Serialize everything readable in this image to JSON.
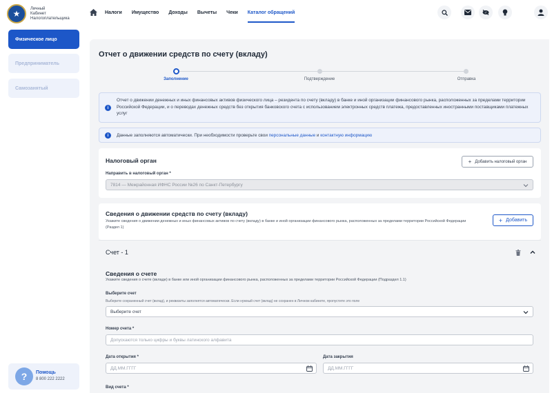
{
  "header": {
    "logo_text": [
      "Личный",
      "Кабинет",
      "Налогоплательщика"
    ],
    "nav": [
      "Налоги",
      "Имущество",
      "Доходы",
      "Вычеты",
      "Чеки",
      "Каталог обращений"
    ],
    "active_nav": "Каталог обращений"
  },
  "sidebar": {
    "items": [
      {
        "label": "Физическое лицо",
        "active": true
      },
      {
        "label": "Предприниматель",
        "active": false
      },
      {
        "label": "Самозанятый",
        "active": false
      }
    ],
    "help": {
      "title": "Помощь",
      "phone": "8 800 222 2222",
      "icon": "?"
    }
  },
  "page": {
    "title": "Отчет о движении средств по счету (вкладу)",
    "steps": [
      {
        "label": "Заполнение",
        "active": true
      },
      {
        "label": "Подтверждение",
        "active": false
      },
      {
        "label": "Отправка",
        "active": false
      }
    ],
    "info1": "Отчет о движении денежных и иных финансовых активов физического лица – резидента по счету (вкладу) в банке и иной организации финансового рынка, расположенных за пределами территории Российской Федерации, и о переводах денежных средств без открытия банковского счета с использованием электронных средств платежа, предоставленных иностранными поставщиками платежных услуг",
    "info2_prefix": "Данные заполняются автоматически. При необходимости проверьте свои ",
    "info2_link1": "персональные данные",
    "info2_mid": " и ",
    "info2_link2": "контактную информацию"
  },
  "tax": {
    "title": "Налоговый орган",
    "add_button": "Добавить налоговый орган",
    "label": "Направить в налоговый орган *",
    "value": "7814 — Межрайонная ИФНС России №26 по Санкт-Петербургу"
  },
  "movement": {
    "title": "Сведения о движении средств по счету (вкладу)",
    "subtitle": "Укажите сведения о движении денежных и иных финансовых активов по счету (вкладу) в банке и иной организации финансового рынка, расположенных за пределами территории Российской Федерации (Раздел 1)",
    "add_button": "Добавить"
  },
  "account": {
    "title": "Счет - 1",
    "section_title": "Сведения о счете",
    "section_sub": "Укажите сведения о счете (вкладе) в банке или иной организации финансового рынка, расположенных за пределами территории Российской Федерации (Подраздел 1.1)",
    "select_label": "Выберите счет",
    "select_hint": "Выберите сохраненный счет (вклад), и реквизиты заполнятся автоматически. Если нужный счет (вклад) не сохранен в Личном кабинете, пропустите это поле",
    "select_placeholder": "Выберите счет",
    "number_label": "Номер счета *",
    "number_placeholder": "Допускаются только цифры и буквы латинского алфавита",
    "open_label": "Дата открытия *",
    "open_placeholder": "ДД.ММ.ГГГГ",
    "close_label": "Дата закрытия",
    "close_placeholder": "ДД.ММ.ГГГГ",
    "type_label": "Вид счета *"
  }
}
